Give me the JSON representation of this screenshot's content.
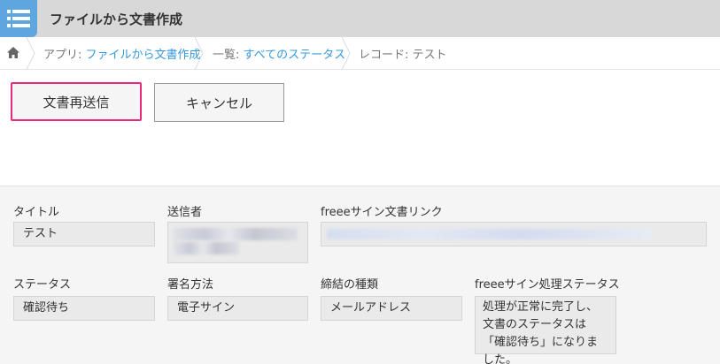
{
  "header": {
    "app_title": "ファイルから文書作成"
  },
  "breadcrumb": {
    "app_prefix": "アプリ: ",
    "app_link": "ファイルから文書作成",
    "list_prefix": "一覧: ",
    "list_link": "すべてのステータス",
    "record": "レコード: テスト"
  },
  "actions": {
    "resend_label": "文書再送信",
    "cancel_label": "キャンセル"
  },
  "fields": {
    "title_label": "タイトル",
    "title_value": "テスト",
    "sender_label": "送信者",
    "link_label": "freeeサイン文書リンク",
    "status_label": "ステータス",
    "status_value": "確認待ち",
    "sign_method_label": "署名方法",
    "sign_method_value": "電子サイン",
    "contract_type_label": "締結の種類",
    "contract_type_value": "メールアドレス",
    "freee_status_label": "freeeサイン処理ステータス",
    "freee_status_value": "処理が正常に完了し、文書のステータスは「確認待ち」になりました。"
  },
  "colors": {
    "accent": "#e82a7b",
    "link": "#3498db",
    "app_icon": "#5ea6e0"
  }
}
